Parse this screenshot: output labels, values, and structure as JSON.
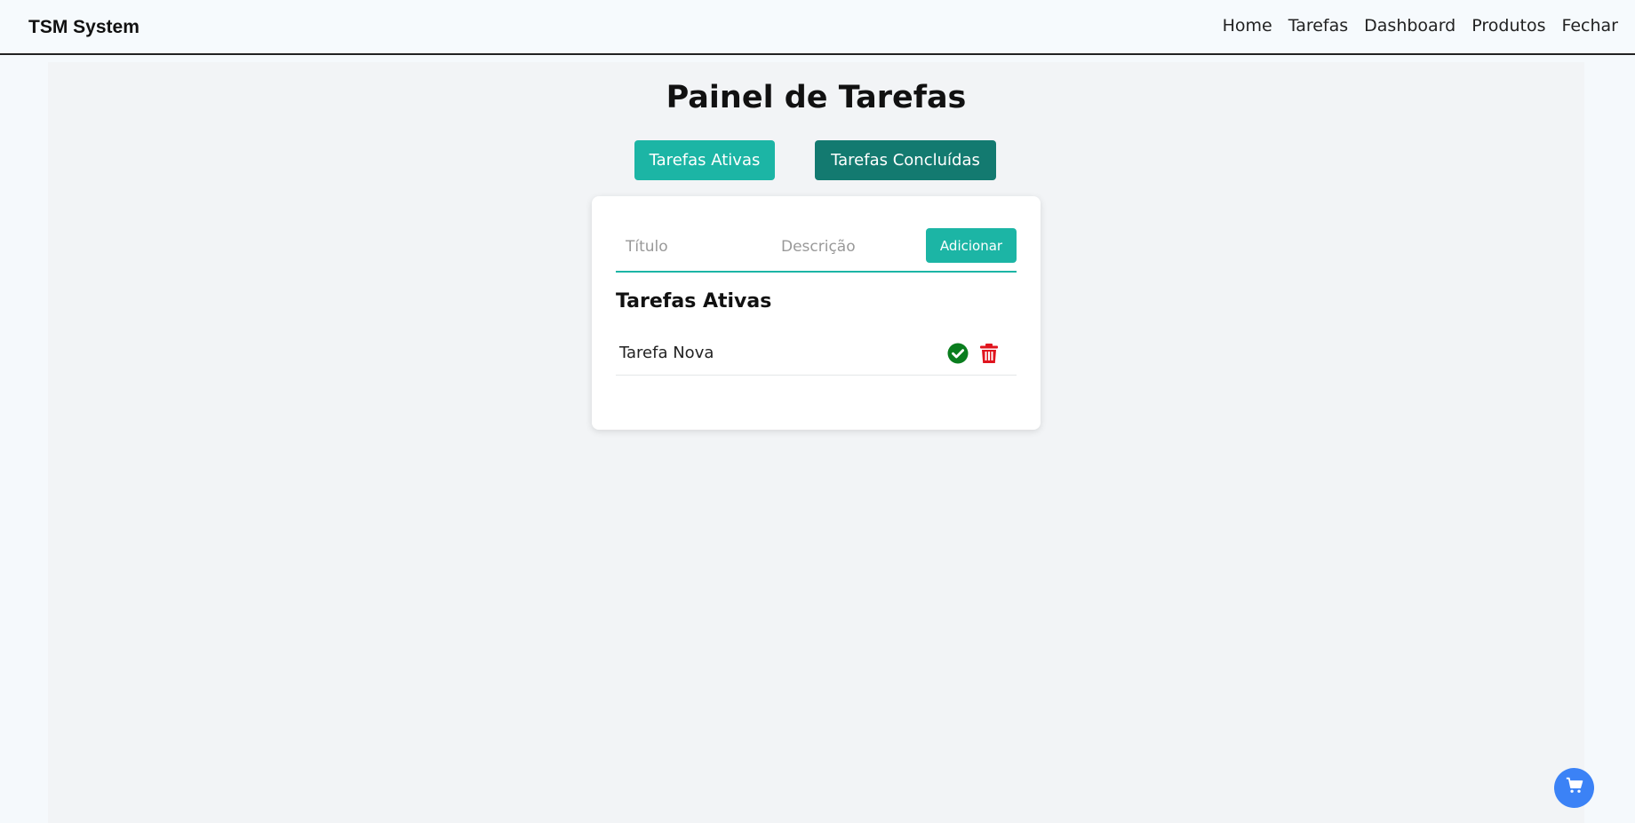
{
  "navbar": {
    "brand": "TSM System",
    "links": [
      "Home",
      "Tarefas",
      "Dashboard",
      "Produtos",
      "Fechar"
    ]
  },
  "page": {
    "title": "Painel de Tarefas"
  },
  "tabs": {
    "active_label": "Tarefas Ativas",
    "done_label": "Tarefas Concluídas"
  },
  "form": {
    "title_placeholder": "Título",
    "title_value": "",
    "description_placeholder": "Descrição",
    "description_value": "",
    "add_label": "Adicionar"
  },
  "task_list": {
    "heading": "Tarefas Ativas",
    "items": [
      {
        "title": "Tarefa Nova",
        "actions": [
          "check-circle-icon",
          "trash-icon"
        ]
      }
    ]
  },
  "fab": {
    "icon": "cart-icon"
  },
  "colors": {
    "accent": "#1cb5a5",
    "accent_dark": "#137a70",
    "complete": "#0a7d1e",
    "delete": "#e0141e",
    "fab": "#3b82f6"
  }
}
